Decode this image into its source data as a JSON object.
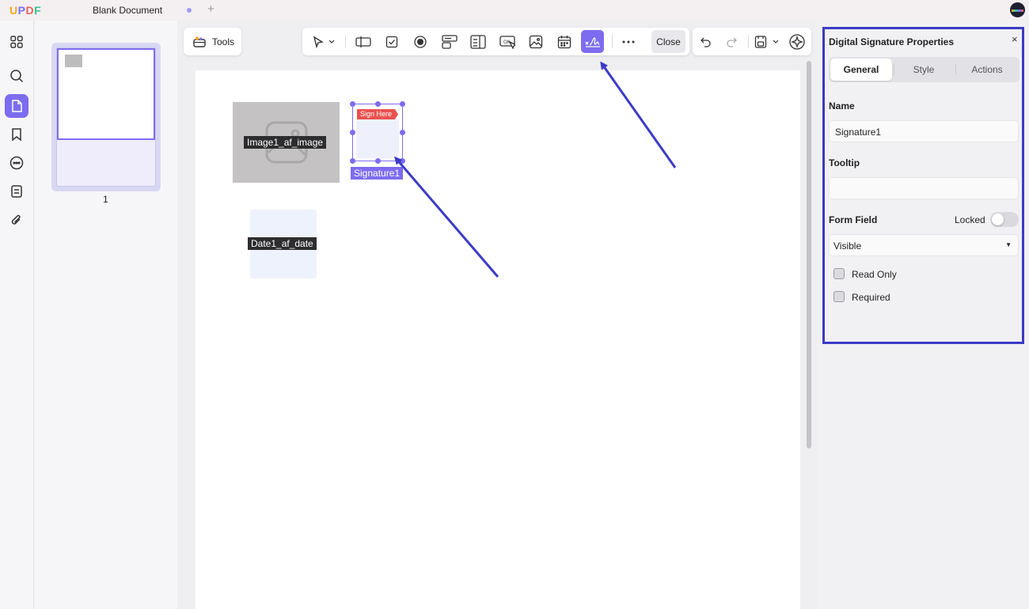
{
  "app": {
    "logo": [
      "U",
      "P",
      "D",
      "F"
    ],
    "document_title": "Blank Document"
  },
  "thumbnails": {
    "page_number": "1"
  },
  "toolbar": {
    "tools_label": "Tools",
    "close_label": "Close"
  },
  "canvas": {
    "image_field_label": "Image1_af_image",
    "signature_tag": "Sign Here",
    "signature_field_label": "Signature1",
    "date_field_label": "Date1_af_date"
  },
  "properties": {
    "title": "Digital Signature Properties",
    "close_symbol": "×",
    "tabs": [
      "General",
      "Style",
      "Actions"
    ],
    "active_tab": "General",
    "name_label": "Name",
    "name_value": "Signature1",
    "tooltip_label": "Tooltip",
    "tooltip_value": "",
    "form_field_label": "Form Field",
    "locked_label": "Locked",
    "locked": false,
    "visibility_value": "Visible",
    "read_only_label": "Read Only",
    "read_only": false,
    "required_label": "Required",
    "required": false
  },
  "colors": {
    "accent": "#7e6cf0",
    "annotation_blue": "#3b3bc6",
    "sign_here_red": "#e9524f"
  },
  "icons": {
    "rail": [
      "grid-icon",
      "search-icon",
      "page-edit-icon",
      "bookmark-icon",
      "comment-icon",
      "form-icon",
      "attachment-icon"
    ],
    "toolbar": [
      "pointer-icon",
      "text-field-icon",
      "checkbox-icon",
      "radio-button-icon",
      "combo-box-icon",
      "list-box-icon",
      "button-icon",
      "image-field-icon",
      "date-field-icon",
      "signature-field-icon",
      "more-icon"
    ]
  }
}
